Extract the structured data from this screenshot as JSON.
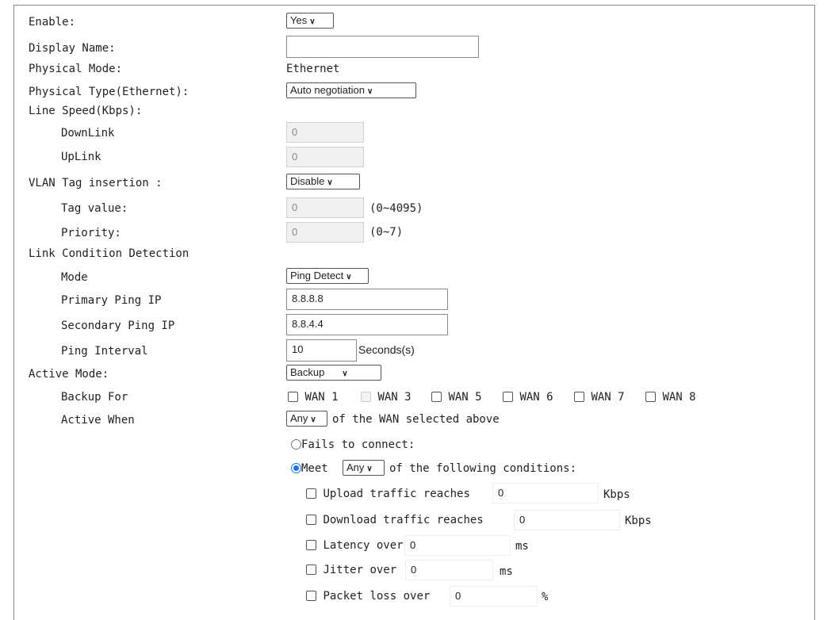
{
  "fields": {
    "enable": {
      "label": "Enable:",
      "value": "Yes"
    },
    "display_name": {
      "label": "Display Name:",
      "value": ""
    },
    "physical_mode": {
      "label": "Physical Mode:",
      "value": "Ethernet"
    },
    "physical_type": {
      "label": "Physical Type(Ethernet):",
      "value": "Auto negotiation"
    },
    "line_speed": {
      "label": "Line Speed(Kbps):"
    },
    "downlink": {
      "label": "DownLink",
      "value": "0"
    },
    "uplink": {
      "label": "UpLink",
      "value": "0"
    },
    "vlan_tag": {
      "label": "VLAN Tag insertion :",
      "value": "Disable"
    },
    "tag_value": {
      "label": "Tag value:",
      "value": "0",
      "hint": "(0~4095)"
    },
    "priority": {
      "label": "Priority:",
      "value": "0",
      "hint": "(0~7)"
    },
    "link_detect": {
      "label": "Link Condition Detection"
    },
    "mode": {
      "label": "Mode",
      "value": "Ping Detect"
    },
    "primary_ping": {
      "label": "Primary Ping IP",
      "value": "8.8.8.8"
    },
    "secondary_ping": {
      "label": "Secondary Ping IP",
      "value": "8.8.4.4"
    },
    "ping_interval": {
      "label": "Ping Interval",
      "value": "10",
      "unit": "Seconds(s)"
    },
    "active_mode": {
      "label": "Active Mode:",
      "value": "Backup"
    },
    "backup_for": {
      "label": "Backup For",
      "wans": [
        {
          "label": "WAN 1",
          "checked": false,
          "disabled": false
        },
        {
          "label": "WAN 3",
          "checked": false,
          "disabled": true
        },
        {
          "label": "WAN 5",
          "checked": false,
          "disabled": false
        },
        {
          "label": "WAN 6",
          "checked": false,
          "disabled": false
        },
        {
          "label": "WAN 7",
          "checked": false,
          "disabled": false
        },
        {
          "label": "WAN 8",
          "checked": false,
          "disabled": false
        }
      ]
    },
    "active_when": {
      "label": "Active When",
      "value": "Any",
      "suffix": "of the WAN selected above"
    },
    "fails_option": {
      "label": "Fails to connect:",
      "selected": false
    },
    "meet_option": {
      "label": "Meet",
      "value": "Any",
      "suffix": "of the following conditions:",
      "selected": true
    }
  },
  "conditions": {
    "upload": {
      "label": "Upload traffic reaches",
      "value": "0",
      "unit": "Kbps",
      "checked": false
    },
    "download": {
      "label": "Download traffic reaches",
      "value": "0",
      "unit": "Kbps",
      "checked": false
    },
    "latency": {
      "label": "Latency over",
      "value": "0",
      "unit": "ms",
      "checked": false
    },
    "jitter": {
      "label": "Jitter over",
      "value": "0",
      "unit": "ms",
      "checked": false
    },
    "packet_loss": {
      "label": "Packet loss over",
      "value": "0",
      "unit": "%",
      "checked": false
    }
  },
  "icons": {
    "dropdown": "chevron-down-icon",
    "checkbox": "checkbox-icon",
    "radio": "radio-icon"
  },
  "colors": {
    "radio_selected": "#1a73e8",
    "border": "#888888"
  }
}
